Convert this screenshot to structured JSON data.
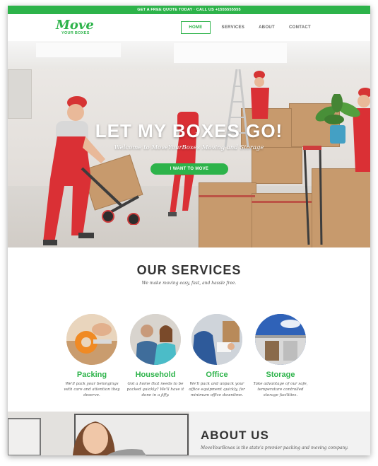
{
  "topbar": {
    "text": "GET A FREE QUOTE TODAY · CALL US +1555555555"
  },
  "logo": {
    "title": "Move",
    "subtitle": "YOUR BOXES"
  },
  "nav": {
    "items": [
      "HOME",
      "SERVICES",
      "ABOUT",
      "CONTACT"
    ],
    "active": "HOME"
  },
  "hero": {
    "title": "LET MY BOXES GO!",
    "subtitle": "Welcome to MoveYourBoxes Moving and Storage",
    "button": "I WANT TO MOVE"
  },
  "services": {
    "title": "OUR SERVICES",
    "subtitle": "We make moving easy, fast, and hassle free.",
    "items": [
      {
        "name": "Packing",
        "desc": "We'll pack your belongings with care and attention they deserve."
      },
      {
        "name": "Household",
        "desc": "Got a home that needs to be packed quickly? We'll have it done in a jiffy."
      },
      {
        "name": "Office",
        "desc": "We'll pack and unpack your office equipment quickly, for minimum office downtime."
      },
      {
        "name": "Storage",
        "desc": "Take advantage of our safe, temperature controlled storage facilities."
      }
    ]
  },
  "about": {
    "title": "ABOUT US",
    "text": "MoveYourBoxes is the state's premier packing and moving company."
  },
  "colors": {
    "accent": "#2db34a",
    "text": "#333333"
  }
}
